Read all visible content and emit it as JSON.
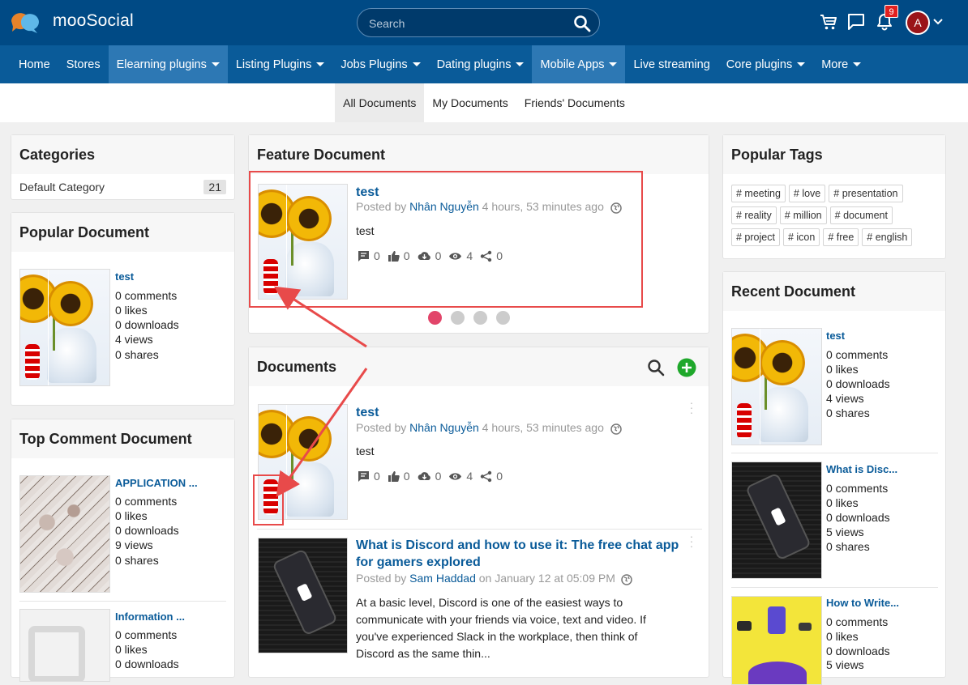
{
  "header": {
    "brand": "mooSocial",
    "search_placeholder": "Search",
    "notification_count": "9",
    "avatar_letter": "A"
  },
  "nav": {
    "items": [
      {
        "label": "Home"
      },
      {
        "label": "Stores"
      },
      {
        "label": "Elearning plugins"
      },
      {
        "label": "Listing Plugins"
      },
      {
        "label": "Jobs Plugins"
      },
      {
        "label": "Dating plugins"
      },
      {
        "label": "Mobile Apps"
      },
      {
        "label": "Live streaming"
      },
      {
        "label": "Core plugins"
      },
      {
        "label": "More"
      }
    ]
  },
  "subnav": {
    "tabs": [
      {
        "label": "All Documents"
      },
      {
        "label": "My Documents"
      },
      {
        "label": "Friends' Documents"
      }
    ]
  },
  "categories": {
    "title": "Categories",
    "items": [
      {
        "name": "Default Category",
        "count": "21"
      }
    ]
  },
  "popular_document": {
    "title": "Popular Document",
    "items": [
      {
        "title": "test",
        "comments": "0 comments",
        "likes": "0 likes",
        "downloads": "0 downloads",
        "views": "4 views",
        "shares": "0 shares"
      }
    ]
  },
  "top_comment_document": {
    "title": "Top Comment Document",
    "items": [
      {
        "title": "APPLICATION ...",
        "comments": "0 comments",
        "likes": "0 likes",
        "downloads": "0 downloads",
        "views": "9 views",
        "shares": "0 shares"
      },
      {
        "title": "Information ...",
        "comments": "0 comments",
        "likes": "0 likes",
        "downloads": "0 downloads"
      }
    ]
  },
  "feature_document": {
    "title": "Feature Document",
    "item": {
      "title": "test",
      "posted_by_prefix": "Posted by",
      "author": "Nhân Nguyễn",
      "time": "4 hours, 53 minutes ago",
      "body": "test",
      "comments": "0",
      "likes": "0",
      "downloads": "0",
      "views": "4",
      "shares": "0"
    }
  },
  "documents": {
    "title": "Documents",
    "items": [
      {
        "title": "test",
        "posted_by_prefix": "Posted by",
        "author": "Nhân Nguyễn",
        "time": "4 hours, 53 minutes ago",
        "body": "test",
        "comments": "0",
        "likes": "0",
        "downloads": "0",
        "views": "4",
        "shares": "0"
      },
      {
        "title_line1": "What is Discord and how to use it: The free chat app",
        "title_line2": "for gamers explored",
        "posted_by_prefix": "Posted by",
        "author": "Sam Haddad",
        "time": "on January 12 at 05:09 PM",
        "body_lines": [
          "At a basic level, Discord is one of the easiest ways to",
          "communicate with your friends via voice, text and video. If",
          "you've experienced Slack in the workplace, then think of",
          "Discord as the same thin..."
        ]
      }
    ]
  },
  "popular_tags": {
    "title": "Popular Tags",
    "tags": [
      "# meeting",
      "# love",
      "# presentation",
      "# reality",
      "# million",
      "# document",
      "# project",
      "# icon",
      "# free",
      "# english"
    ]
  },
  "recent_document": {
    "title": "Recent Document",
    "items": [
      {
        "title": "test",
        "comments": "0 comments",
        "likes": "0 likes",
        "downloads": "0 downloads",
        "views": "4 views",
        "shares": "0 shares"
      },
      {
        "title": "What is Disc...",
        "comments": "0 comments",
        "likes": "0 likes",
        "downloads": "0 downloads",
        "views": "5 views",
        "shares": "0 shares"
      },
      {
        "title": "How to Write...",
        "comments": "0 comments",
        "likes": "0 likes",
        "downloads": "0 downloads",
        "views": "5 views"
      }
    ]
  },
  "colors": {
    "header_bg": "#004a85",
    "nav_bg": "#0a5b99",
    "nav_active": "#2d78b4",
    "link": "#0a5b99",
    "carousel_active": "#e2456a",
    "highlight": "#e84a4a",
    "add_button": "#1fa82b"
  }
}
